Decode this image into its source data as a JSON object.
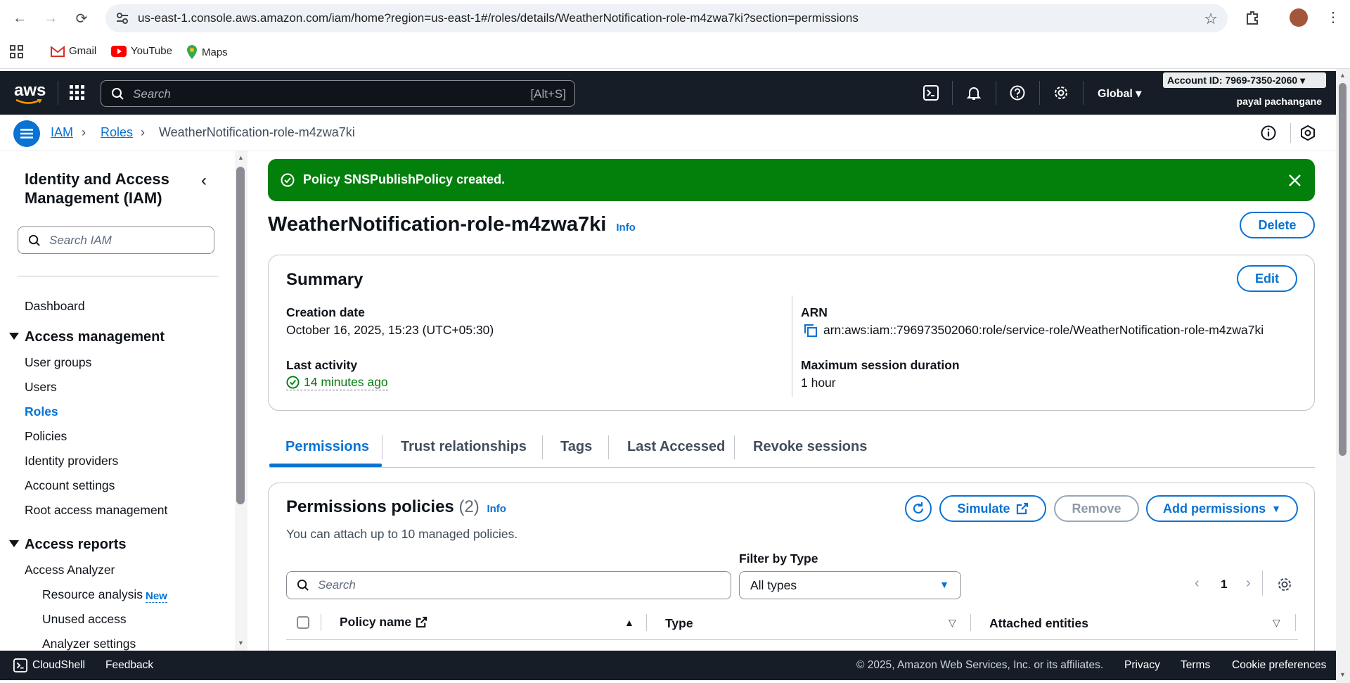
{
  "browser": {
    "url": "us-east-1.console.aws.amazon.com/iam/home?region=us-east-1#/roles/details/WeatherNotification-role-m4zwa7ki?section=permissions",
    "bookmarks": [
      "Gmail",
      "YouTube",
      "Maps"
    ]
  },
  "aws_nav": {
    "logo": "aws",
    "search_placeholder": "Search",
    "search_shortcut": "[Alt+S]",
    "region": "Global",
    "account_id": "Account ID: 7969-7350-2060",
    "user": "payal pachangane"
  },
  "breadcrumb": {
    "items": [
      "IAM",
      "Roles",
      "WeatherNotification-role-m4zwa7ki"
    ]
  },
  "sidebar": {
    "title": "Identity and Access Management (IAM)",
    "search_placeholder": "Search IAM",
    "dashboard": "Dashboard",
    "access_management": {
      "heading": "Access management",
      "items": [
        "User groups",
        "Users",
        "Roles",
        "Policies",
        "Identity providers",
        "Account settings",
        "Root access management"
      ],
      "active": "Roles"
    },
    "access_reports": {
      "heading": "Access reports",
      "items": [
        "Access Analyzer"
      ],
      "subitems": [
        "Resource analysis",
        "Unused access",
        "Analyzer settings"
      ],
      "new_badge": "New"
    }
  },
  "flash": {
    "message": "Policy SNSPublishPolicy created.",
    "color": "#037f0c"
  },
  "header": {
    "title": "WeatherNotification-role-m4zwa7ki",
    "info": "Info",
    "delete_label": "Delete"
  },
  "summary": {
    "title": "Summary",
    "edit_label": "Edit",
    "creation_date_label": "Creation date",
    "creation_date": "October 16, 2025, 15:23 (UTC+05:30)",
    "last_activity_label": "Last activity",
    "last_activity": "14 minutes ago",
    "arn_label": "ARN",
    "arn": "arn:aws:iam::796973502060:role/service-role/WeatherNotification-role-m4zwa7ki",
    "max_session_label": "Maximum session duration",
    "max_session": "1 hour"
  },
  "tabs": [
    "Permissions",
    "Trust relationships",
    "Tags",
    "Last Accessed",
    "Revoke sessions"
  ],
  "active_tab": "Permissions",
  "permissions": {
    "title": "Permissions policies",
    "count": "(2)",
    "info": "Info",
    "description": "You can attach up to 10 managed policies.",
    "simulate_label": "Simulate",
    "remove_label": "Remove",
    "add_label": "Add permissions",
    "filter_label": "Filter by Type",
    "search_placeholder": "Search",
    "filter_value": "All types",
    "page": "1",
    "columns": [
      "Policy name",
      "Type",
      "Attached entities"
    ]
  },
  "footer": {
    "cloudshell": "CloudShell",
    "feedback": "Feedback",
    "copyright": "© 2025, Amazon Web Services, Inc. or its affiliates.",
    "privacy": "Privacy",
    "terms": "Terms",
    "cookies": "Cookie preferences"
  },
  "colors": {
    "accent": "#0972d3",
    "nav_bg": "#161d26",
    "success": "#037f0c"
  }
}
